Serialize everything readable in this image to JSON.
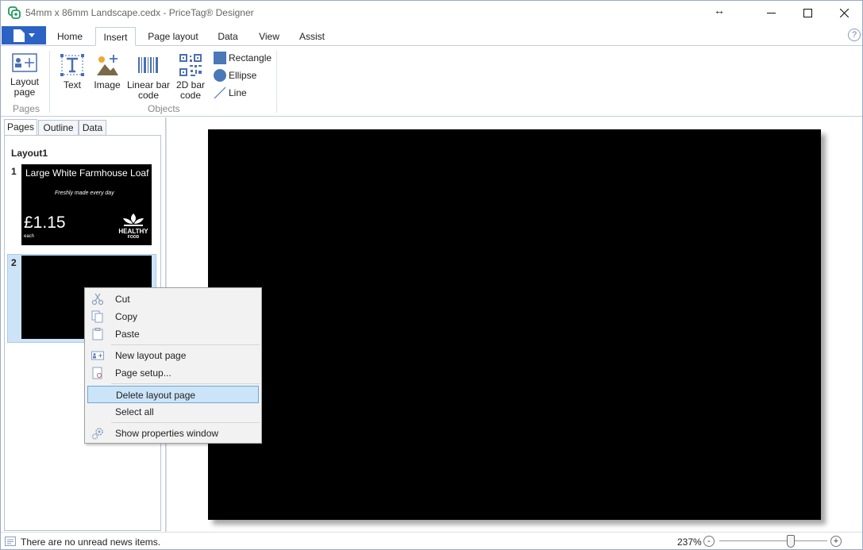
{
  "window": {
    "title": "54mm x 86mm Landscape.cedx - PriceTag® Designer",
    "resize_glyph": "↔"
  },
  "ribbon": {
    "tabs": [
      {
        "label": "Home"
      },
      {
        "label": "Insert"
      },
      {
        "label": "Page layout"
      },
      {
        "label": "Data"
      },
      {
        "label": "View"
      },
      {
        "label": "Assist"
      }
    ],
    "active_tab": "Insert",
    "help_label": "?",
    "pages_group": {
      "label": "Pages",
      "layout_page_label": "Layout page"
    },
    "objects_group": {
      "label": "Objects",
      "text_label": "Text",
      "image_label": "Image",
      "linear_barcode_label": "Linear bar code",
      "barcode_2d_label": "2D bar code",
      "rectangle_label": "Rectangle",
      "ellipse_label": "Ellipse",
      "line_label": "Line"
    }
  },
  "left_pane": {
    "tabs": [
      {
        "label": "Pages"
      },
      {
        "label": "Outline"
      },
      {
        "label": "Data"
      }
    ],
    "active_tab": "Pages",
    "layout_name": "Layout1",
    "pages": [
      {
        "number": "1",
        "title": "Large White Farmhouse Loaf",
        "subtitle": "Freshly made every day",
        "price": "£1.15",
        "unit": "each",
        "logo_text": "HEALTHY",
        "logo_subtext": "FOOD"
      },
      {
        "number": "2",
        "selected": true
      }
    ]
  },
  "context_menu": {
    "items": [
      {
        "label": "Cut",
        "icon": "scissors-icon"
      },
      {
        "label": "Copy",
        "icon": "copy-icon"
      },
      {
        "label": "Paste",
        "icon": "paste-icon"
      },
      {
        "label": "New layout page",
        "icon": "new-layout-page-icon"
      },
      {
        "label": "Page setup...",
        "icon": "page-setup-icon"
      },
      {
        "label": "Delete layout page",
        "icon": "",
        "highlighted": true
      },
      {
        "label": "Select all",
        "icon": ""
      },
      {
        "label": "Show properties window",
        "icon": "gears-icon"
      }
    ]
  },
  "status_bar": {
    "news_text": "There are no unread news items.",
    "zoom_label": "237%",
    "zoom_minus": "-",
    "zoom_plus": "+"
  },
  "colors": {
    "accent": "#2b62c4",
    "highlight": "#cce4f7",
    "selection_border": "#6aa8dc",
    "canvas_page": "#000000"
  }
}
